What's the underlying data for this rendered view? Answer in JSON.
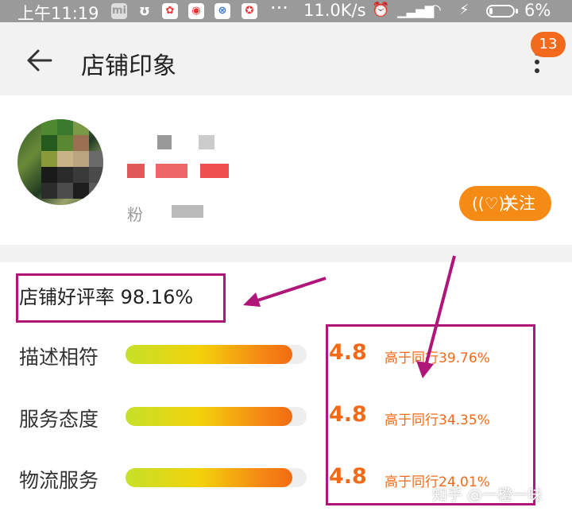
{
  "status_bar": {
    "time": "上午11:19",
    "more": "···",
    "net_speed": "11.0K/s",
    "battery_pct": "6%",
    "notif_icons": [
      "app-icon-1",
      "app-icon-2",
      "app-icon-3",
      "app-icon-4",
      "app-icon-5",
      "app-icon-6"
    ]
  },
  "header": {
    "title": "店铺印象",
    "badge": "13"
  },
  "shop": {
    "fans_label": "粉",
    "follow_label": "关注",
    "follow_icon": "((♡))"
  },
  "rating": {
    "overall": "店铺好评率 98.16%",
    "rows": [
      {
        "label": "描述相符",
        "score": "4.8",
        "compare": "高于同行39.76%",
        "level": 0.92
      },
      {
        "label": "服务态度",
        "score": "4.8",
        "compare": "高于同行34.35%",
        "level": 0.92
      },
      {
        "label": "物流服务",
        "score": "4.8",
        "compare": "高于同行24.01%",
        "level": 0.92
      }
    ]
  },
  "watermark": "知乎 @一橙一味",
  "colors": {
    "accent": "#f26a18",
    "annotation": "#b0157a",
    "follow_btn": "#f58a14"
  }
}
